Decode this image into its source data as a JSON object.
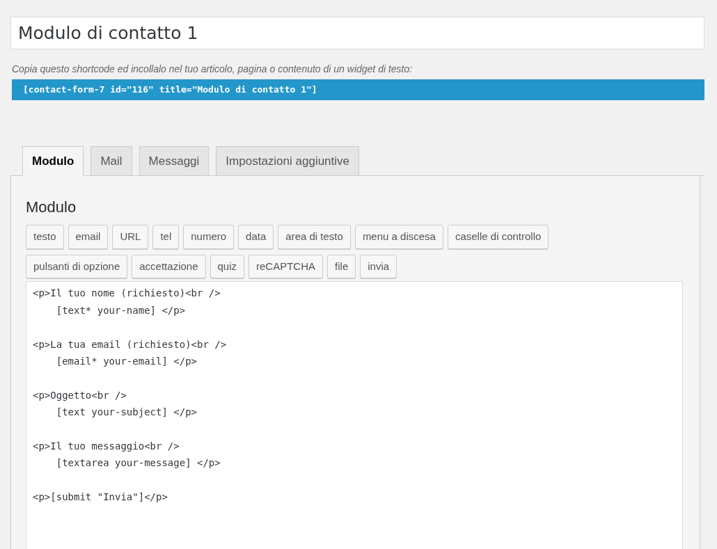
{
  "title_field": {
    "value": "Modulo di contatto 1"
  },
  "shortcode_hint": "Copia questo shortcode ed incollalo nel tuo articolo, pagina o contenuto di un widget di testo:",
  "shortcode": "[contact-form-7 id=\"116\" title=\"Modulo di contatto 1\"]",
  "tabs": [
    {
      "label": "Modulo",
      "selected": true
    },
    {
      "label": "Mail",
      "selected": false
    },
    {
      "label": "Messaggi",
      "selected": false
    },
    {
      "label": "Impostazioni aggiuntive",
      "selected": false
    }
  ],
  "panel": {
    "heading": "Modulo",
    "tag_buttons": [
      "testo",
      "email",
      "URL",
      "tel",
      "numero",
      "data",
      "area di testo",
      "menu a discesa",
      "caselle di controllo",
      "pulsanti di opzione",
      "accettazione",
      "quiz",
      "reCAPTCHA",
      "file",
      "invia"
    ],
    "form_code": "<p>Il tuo nome (richiesto)<br />\n    [text* your-name] </p>\n\n<p>La tua email (richiesto)<br />\n    [email* your-email] </p>\n\n<p>Oggetto<br />\n    [text your-subject] </p>\n\n<p>Il tuo messaggio<br />\n    [textarea your-message] </p>\n\n<p>[submit \"Invia\"]</p>"
  }
}
